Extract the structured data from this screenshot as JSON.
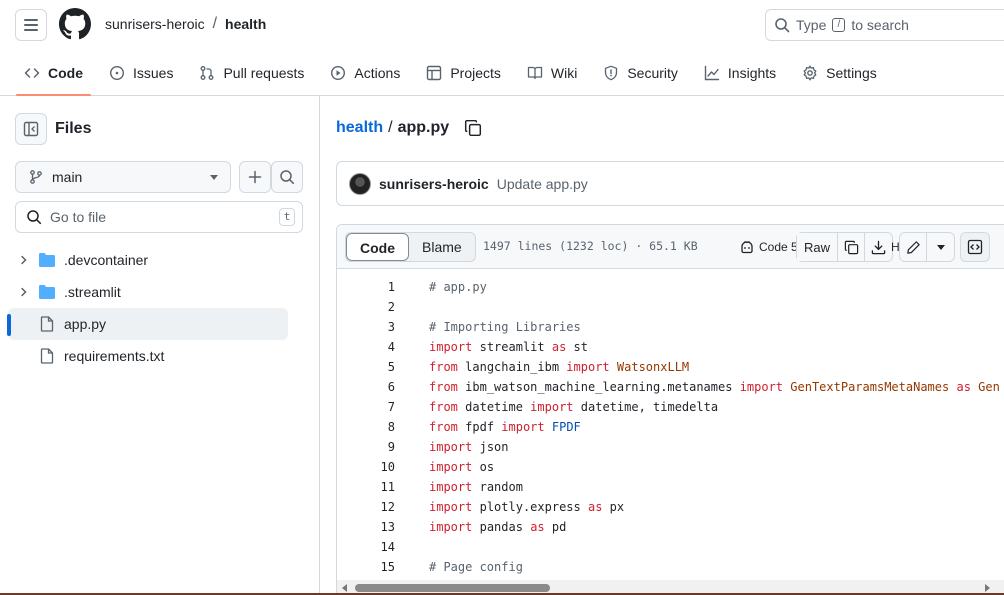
{
  "header": {
    "owner": "sunrisers-heroic",
    "separator": "/",
    "repo": "health",
    "search_prefix": "Type",
    "search_key": "/",
    "search_suffix": "to search"
  },
  "tabs": [
    {
      "label": "Code",
      "icon": "code-icon",
      "active": true
    },
    {
      "label": "Issues",
      "icon": "issue-icon"
    },
    {
      "label": "Pull requests",
      "icon": "pull-request-icon"
    },
    {
      "label": "Actions",
      "icon": "play-icon"
    },
    {
      "label": "Projects",
      "icon": "table-icon"
    },
    {
      "label": "Wiki",
      "icon": "book-icon"
    },
    {
      "label": "Security",
      "icon": "shield-icon"
    },
    {
      "label": "Insights",
      "icon": "graph-icon"
    },
    {
      "label": "Settings",
      "icon": "gear-icon"
    }
  ],
  "sidebar": {
    "title": "Files",
    "branch": "main",
    "goto_placeholder": "Go to file",
    "goto_key": "t",
    "tree": [
      {
        "name": ".devcontainer",
        "type": "folder"
      },
      {
        "name": ".streamlit",
        "type": "folder"
      },
      {
        "name": "app.py",
        "type": "file",
        "selected": true
      },
      {
        "name": "requirements.txt",
        "type": "file"
      }
    ]
  },
  "file": {
    "root": "health",
    "separator": "/",
    "name": "app.py"
  },
  "commit": {
    "author": "sunrisers-heroic",
    "message": "Update app.py"
  },
  "code_header": {
    "code_tab": "Code",
    "blame_tab": "Blame",
    "meta": "1497 lines (1232 loc) · 65.1 KB",
    "copilot_label": "Code 5",
    "raw_label": "Raw",
    "hidden_label": "H"
  },
  "code_lines": [
    {
      "n": "1",
      "t": "# app.py"
    },
    {
      "n": "2",
      "t": ""
    },
    {
      "n": "3",
      "t": "# Importing Libraries"
    },
    {
      "n": "4",
      "t": "import streamlit as st"
    },
    {
      "n": "5",
      "t": "from langchain_ibm import WatsonxLLM"
    },
    {
      "n": "6",
      "t": "from ibm_watson_machine_learning.metanames import GenTextParamsMetaNames as Gen"
    },
    {
      "n": "7",
      "t": "from datetime import datetime, timedelta"
    },
    {
      "n": "8",
      "t": "from fpdf import FPDF"
    },
    {
      "n": "9",
      "t": "import json"
    },
    {
      "n": "10",
      "t": "import os"
    },
    {
      "n": "11",
      "t": "import random"
    },
    {
      "n": "12",
      "t": "import plotly.express as px"
    },
    {
      "n": "13",
      "t": "import pandas as pd"
    },
    {
      "n": "14",
      "t": ""
    },
    {
      "n": "15",
      "t": "# Page config"
    }
  ],
  "colors": {
    "accent": "#0969da",
    "active_tab_underline": "#fd8c73",
    "keyword": "#cf222e",
    "comment": "#59636e",
    "class_name": "#953800",
    "builtin": "#0550ae"
  }
}
